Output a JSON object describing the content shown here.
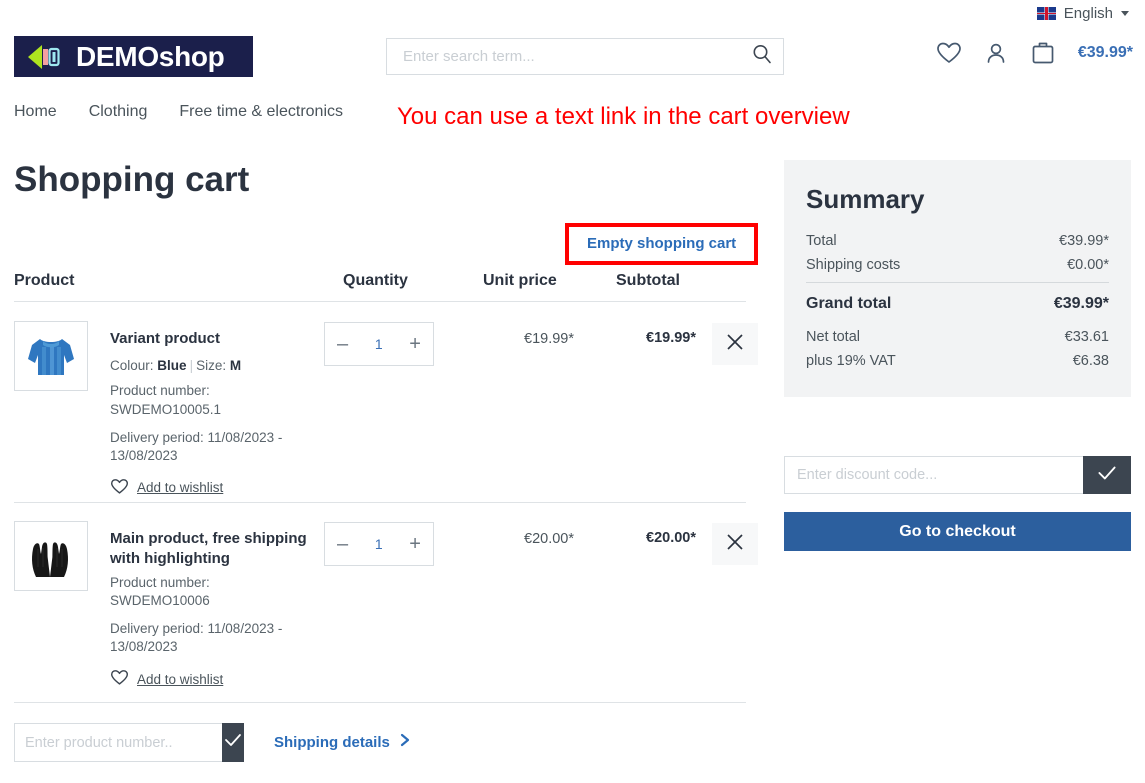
{
  "topbar": {
    "flag_icon": "uk-flag-icon",
    "language": "English",
    "caret_icon": "chevron-down-icon"
  },
  "header": {
    "logo_text": "DEMOshop",
    "logo_icon": "demoshop-logo-icon",
    "search": {
      "placeholder": "Enter search term...",
      "value": "",
      "icon": "search-icon"
    },
    "icons": {
      "wishlist": "heart-icon",
      "account": "person-icon",
      "cart": "shopping-bag-icon"
    },
    "cart_amount": "€39.99*"
  },
  "nav": {
    "items": [
      {
        "label": "Home"
      },
      {
        "label": "Clothing"
      },
      {
        "label": "Free time & electronics"
      }
    ]
  },
  "annotation": {
    "text": "You can use a text link in the cart overview",
    "color": "#ff0000"
  },
  "main": {
    "page_title": "Shopping cart",
    "empty_cart_label": "Empty shopping cart",
    "highlight_color": "#ff0000",
    "columns": {
      "product": "Product",
      "quantity": "Quantity",
      "unit_price": "Unit price",
      "subtotal": "Subtotal"
    },
    "rows": [
      {
        "thumb_icon": "blue-sweater-thumbnail",
        "name": "Variant product",
        "variant_colour_label": "Colour:",
        "variant_colour_value": "Blue",
        "variant_size_label": "Size:",
        "variant_size_value": "M",
        "product_number_label": "Product number:",
        "product_number": "SWDEMO10005.1",
        "delivery": "Delivery period: 11/08/2023 - 13/08/2023",
        "wishlist_label": "Add to wishlist",
        "wishlist_icon": "heart-icon",
        "qty_minus": "–",
        "qty_value": "1",
        "qty_plus": "+",
        "unit_price": "€19.99*",
        "subtotal": "€19.99*",
        "remove_icon": "close-icon"
      },
      {
        "thumb_icon": "black-gloves-thumbnail",
        "name": "Main product, free shipping with highlighting",
        "product_number_label": "Product number:",
        "product_number": "SWDEMO10006",
        "delivery": "Delivery period: 11/08/2023 - 13/08/2023",
        "wishlist_label": "Add to wishlist",
        "wishlist_icon": "heart-icon",
        "qty_minus": "–",
        "qty_value": "1",
        "qty_plus": "+",
        "unit_price": "€20.00*",
        "subtotal": "€20.00*",
        "remove_icon": "close-icon"
      }
    ],
    "product_number_input": {
      "placeholder": "Enter product number..",
      "value": "",
      "submit_icon": "check-icon"
    },
    "shipping_details_label": "Shipping details",
    "shipping_details_icon": "chevron-right-icon"
  },
  "summary": {
    "title": "Summary",
    "rows": [
      {
        "label": "Total",
        "value": "€39.99*"
      },
      {
        "label": "Shipping costs",
        "value": "€0.00*"
      }
    ],
    "grand_total_label": "Grand total",
    "grand_total_value": "€39.99*",
    "after_rows": [
      {
        "label": "Net total",
        "value": "€33.61"
      },
      {
        "label": "plus 19% VAT",
        "value": "€6.38"
      }
    ],
    "discount": {
      "placeholder": "Enter discount code...",
      "value": "",
      "submit_icon": "check-icon"
    },
    "checkout_label": "Go to checkout",
    "checkout_color": "#2c5f9e"
  }
}
